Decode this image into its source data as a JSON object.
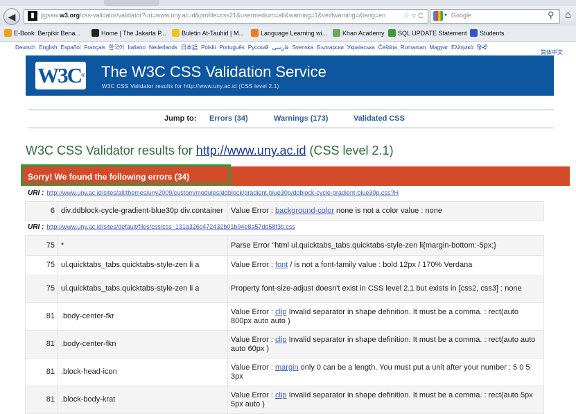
{
  "browser": {
    "url_prefix": "jigsaw.",
    "url_host": "w3.org",
    "url_path": "/css-validator/validator?uri=www.uny.ac.id&profile=css21&usermedium=all&warning=1&vextwarning=&lang=en",
    "search_placeholder": "Google",
    "bookmarks": [
      {
        "label": "E-Book: Berpikir Bena...",
        "color": "#e8a317"
      },
      {
        "label": "Home | The Jakarta P...",
        "color": "#222222"
      },
      {
        "label": "Buletin At-Tauhid | M...",
        "color": "#f0c419"
      },
      {
        "label": "Language Learning wi...",
        "color": "#f07a1f"
      },
      {
        "label": "Khan Academy",
        "color": "#6aa84f"
      },
      {
        "label": "SQL UPDATE Statement",
        "color": "#3d9a3a"
      },
      {
        "label": "Students",
        "color": "#3355cc"
      }
    ]
  },
  "languages": [
    "Deutsch",
    "English",
    "Español",
    "Français",
    "한국어",
    "Italiano",
    "Nederlands",
    "日本語",
    "Polski",
    "Português",
    "Русский",
    "فارسی",
    "Svenska",
    "Български",
    "Українська",
    "Čeština",
    "Romanian",
    "Magyar",
    "Ελληνικά",
    "हिन्दी"
  ],
  "languages_extra": "简体中文",
  "banner": {
    "logo": "W3C",
    "title": "The W3C CSS Validation Service",
    "subtitle": "W3C CSS Validator results for http://www.uny.ac.id (CSS level 2.1)"
  },
  "jump": {
    "label": "Jump to:",
    "errors": "Errors (34)",
    "warnings": "Warnings (173)",
    "validated": "Validated CSS"
  },
  "results": {
    "title_prefix": "W3C CSS Validator results for",
    "link": "http://www.uny.ac.id",
    "title_suffix": "(CSS level 2.1)",
    "error_heading": "Sorry! We found the following errors (34)"
  },
  "uri1": {
    "label": "URI :",
    "href": "http://www.uny.ac.id/sites/all/themes/uny2009/custom/modules/ddblock/gradient-blue30p/ddblock-cycle-gradient-blue30p.css?H"
  },
  "group1": [
    {
      "line": "6",
      "context": "div.ddblock-cycle-gradient-blue30p div.container",
      "pre": "Value Error : ",
      "prop": "background-color",
      "post": " none is not a color value : none"
    }
  ],
  "uri2": {
    "label": "URI :",
    "href": "http://www.uny.ac.id/sites/default/files/css/css_131a326c472432b01b94e8a57dd58f3b.css"
  },
  "group2": [
    {
      "line": "75",
      "context": "*",
      "pre": "Parse Error \"html ul.quicktabs_tabs.quicktabs-style-zen li{margin-bottom:-5px;}",
      "prop": "",
      "post": ""
    },
    {
      "line": "75",
      "context": "ul.quicktabs_tabs.quicktabs-style-zen li a",
      "pre": "Value Error : ",
      "prop": "font",
      "post": " / is not a font-family value : bold 12px / 170% Verdana"
    },
    {
      "line": "75",
      "context": "ul.quicktabs_tabs.quicktabs-style-zen li a",
      "pre": "Property font-size-adjust doesn't exist in CSS level 2.1 but exists in [css2, css3] : none",
      "prop": "",
      "post": ""
    },
    {
      "line": "81",
      "context": ".body-center-fkr",
      "pre": "Value Error : ",
      "prop": "clip",
      "post": " Invalid separator in shape definition. It must be a comma. : rect(auto 800px auto auto )"
    },
    {
      "line": "81",
      "context": ".body-center-fkn",
      "pre": "Value Error : ",
      "prop": "clip",
      "post": " Invalid separator in shape definition. It must be a comma. : rect(auto auto auto 60px )"
    },
    {
      "line": "81",
      "context": ".block-head-icon",
      "pre": "Value Error : ",
      "prop": "margin",
      "post": " only 0 can be a length. You must put a unit after your number : 5 0 5 3px"
    },
    {
      "line": "81",
      "context": ".block-body-krat",
      "pre": "Value Error : ",
      "prop": "clip",
      "post": " Invalid separator in shape definition. It must be a comma. : rect(auto 5px 5px auto )"
    }
  ]
}
